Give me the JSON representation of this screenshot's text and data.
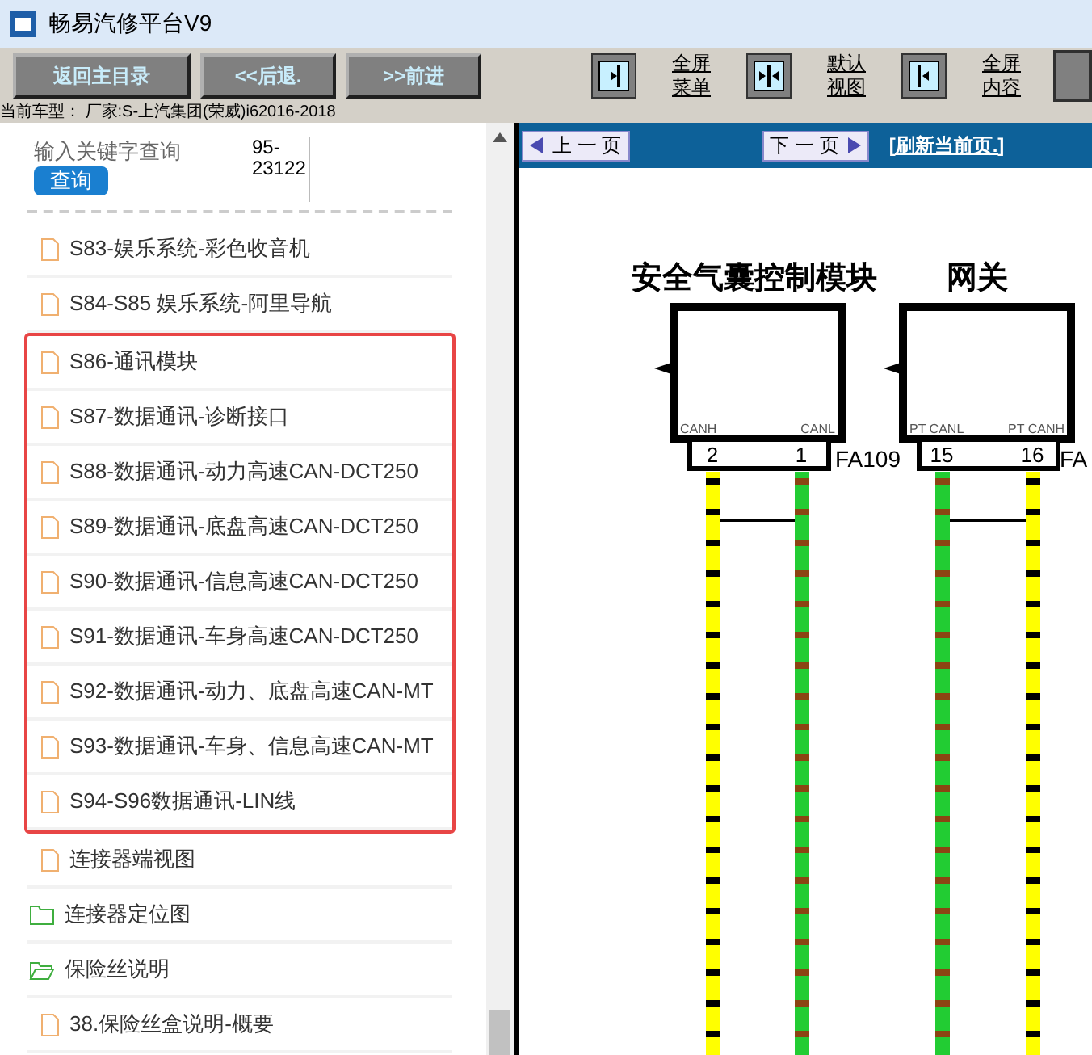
{
  "window": {
    "title": "畅易汽修平台V9"
  },
  "toolbar": {
    "nav_buttons": [
      "返回主目录",
      "<<后退.",
      ">>前进"
    ],
    "view_buttons": [
      {
        "kind": "menu",
        "label_1": "全屏",
        "label_2": "菜单"
      },
      {
        "kind": "default",
        "label_1": "默认",
        "label_2": "视图"
      },
      {
        "kind": "content",
        "label_1": "全屏",
        "label_2": "内容"
      }
    ]
  },
  "car_info": "当前车型： 厂家:S-上汽集团(荣威)i62016-2018",
  "search": {
    "label": "输入关键字查询",
    "button": "查询",
    "code": "95-\n23122"
  },
  "tree_top": [
    {
      "kind": "file",
      "label": "S83-娱乐系统-彩色收音机"
    },
    {
      "kind": "file",
      "label": "S84-S85 娱乐系统-阿里导航"
    }
  ],
  "highlighted_group": [
    {
      "kind": "file",
      "label": "S86-通讯模块"
    },
    {
      "kind": "file",
      "label": "S87-数据通讯-诊断接口"
    },
    {
      "kind": "file",
      "label": "S88-数据通讯-动力高速CAN-DCT250"
    },
    {
      "kind": "file",
      "label": "S89-数据通讯-底盘高速CAN-DCT250"
    },
    {
      "kind": "file",
      "label": "S90-数据通讯-信息高速CAN-DCT250"
    },
    {
      "kind": "file",
      "label": "S91-数据通讯-车身高速CAN-DCT250"
    },
    {
      "kind": "file",
      "label": "S92-数据通讯-动力、底盘高速CAN-MT"
    },
    {
      "kind": "file",
      "label": "S93-数据通讯-车身、信息高速CAN-MT"
    },
    {
      "kind": "file",
      "label": "S94-S96数据通讯-LIN线"
    }
  ],
  "tree_bottom": [
    {
      "kind": "file",
      "label": "连接器端视图"
    },
    {
      "kind": "folder",
      "label": "连接器定位图",
      "expanded": false
    },
    {
      "kind": "folder",
      "label": "保险丝说明",
      "expanded": true
    },
    {
      "kind": "file",
      "label": "38.保险丝盒说明-概要"
    }
  ],
  "page_nav": {
    "prev": "上 一 页",
    "next": "下 一 页",
    "refresh": "[刷新当前页.]"
  },
  "diagram": {
    "modules": [
      {
        "title": "安全气囊控制模块",
        "pins": [
          {
            "name": "CANH",
            "number": "2",
            "color": "#ffff00"
          },
          {
            "name": "CANL",
            "number": "1",
            "color": "#22cc33"
          }
        ],
        "connector": "FA109"
      },
      {
        "title": "网关",
        "pins": [
          {
            "name": "PT CANL",
            "number": "15",
            "color": "#22cc33"
          },
          {
            "name": "PT CANH",
            "number": "16",
            "color": "#ffff00"
          }
        ],
        "connector": "FA"
      }
    ]
  }
}
